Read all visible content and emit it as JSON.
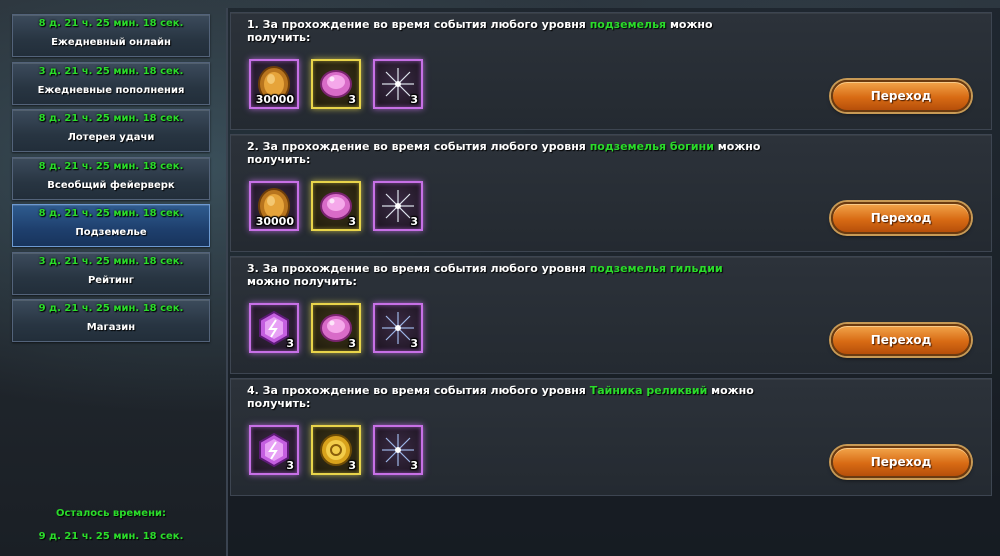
{
  "sidebar": {
    "items": [
      {
        "timer": "8 д. 21 ч. 25 мин. 18 сек.",
        "label": "Ежедневный онлайн"
      },
      {
        "timer": "3 д. 21 ч. 25 мин. 18 сек.",
        "label": "Ежедневные пополнения"
      },
      {
        "timer": "8 д. 21 ч. 25 мин. 18 сек.",
        "label": "Лотерея удачи"
      },
      {
        "timer": "8 д. 21 ч. 25 мин. 18 сек.",
        "label": "Всеобщий фейерверк"
      },
      {
        "timer": "8 д. 21 ч. 25 мин. 18 сек.",
        "label": "Подземелье"
      },
      {
        "timer": "3 д. 21 ч. 25 мин. 18 сек.",
        "label": "Рейтинг"
      },
      {
        "timer": "9 д. 21 ч. 25 мин. 18 сек.",
        "label": "Магазин"
      }
    ],
    "active_index": 4,
    "remaining_label": "Осталось времени:",
    "remaining_time": "9 д. 21 ч. 25 мин. 18 сек."
  },
  "tasks": [
    {
      "prefix": "1. За прохождение во время события любого уровня ",
      "highlight": "подземелья",
      "suffix": " можно получить:",
      "button": "Переход",
      "rewards": [
        {
          "icon": "gold-coin-icon",
          "qty": "30000"
        },
        {
          "icon": "pink-gem-icon",
          "qty": "3"
        },
        {
          "icon": "firework-icon",
          "qty": "3"
        }
      ]
    },
    {
      "prefix": "2. За прохождение во время события любого уровня ",
      "highlight": "подземелья богини",
      "suffix": " можно получить:",
      "button": "Переход",
      "rewards": [
        {
          "icon": "gold-coin-icon",
          "qty": "30000"
        },
        {
          "icon": "pink-gem-icon",
          "qty": "3"
        },
        {
          "icon": "firework-icon",
          "qty": "3"
        }
      ]
    },
    {
      "prefix": "3. За прохождение во время события любого уровня ",
      "highlight": "подземелья гильдии",
      "suffix": " можно получить:",
      "button": "Переход",
      "rewards": [
        {
          "icon": "purple-crystal-icon",
          "qty": "3"
        },
        {
          "icon": "pink-gem-icon",
          "qty": "3"
        },
        {
          "icon": "firework-icon",
          "qty": "3"
        }
      ]
    },
    {
      "prefix": "4. За прохождение во время события любого уровня ",
      "highlight": "Тайника реликвий",
      "suffix": " можно получить:",
      "button": "Переход",
      "rewards": [
        {
          "icon": "purple-crystal-icon",
          "qty": "3"
        },
        {
          "icon": "gold-medal-icon",
          "qty": "3"
        },
        {
          "icon": "firework-icon",
          "qty": "3"
        }
      ]
    }
  ],
  "colors": {
    "highlight": "#2bdc2b",
    "button": "#d86b14",
    "frame_purple": "#c770e6",
    "frame_gold": "#e8d44a"
  }
}
